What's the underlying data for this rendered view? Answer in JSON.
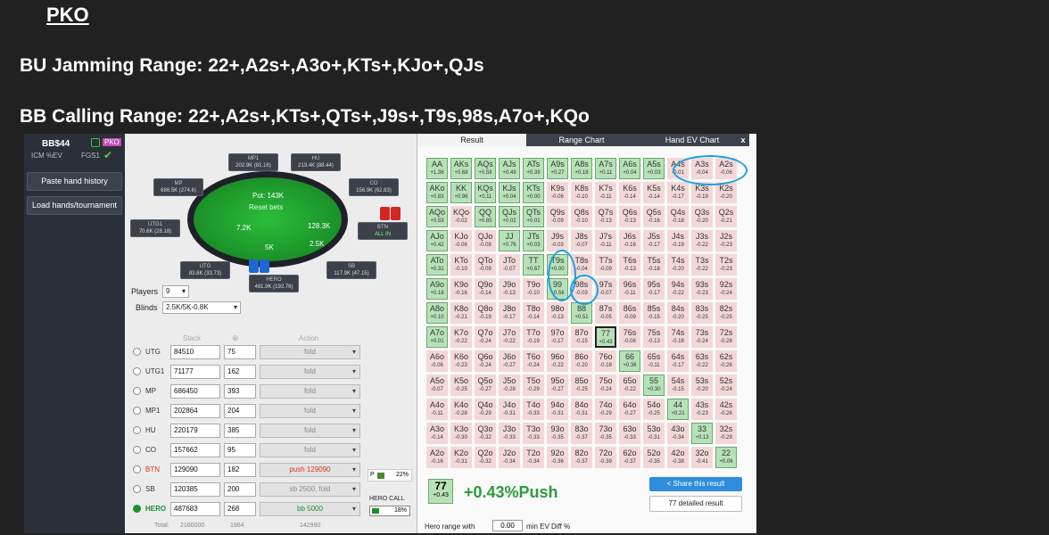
{
  "slide": {
    "title": "PKO",
    "bu_range": "BU Jamming Range: 22+,A2s+,A3o+,KTs+,KJo+,QJs",
    "bb_range": "BB Calling Range: 22+,A2s+,KTs+,QTs+,J9s+,T9s,98s,A7o+,KQo"
  },
  "sidebar": {
    "stack_label": "BB$44",
    "pko_badge": "PKO",
    "icm_label": "ICM %EV",
    "fgs_label": "FGS1",
    "paste_button": "Paste hand history",
    "load_button": "Load hands/tournament"
  },
  "table": {
    "pot": "Pot: 143K",
    "reset_bets": "Reset bets",
    "bet_left": "7.2K",
    "bet_center": "5K",
    "bet_right1": "128.3K",
    "bet_right2": "2.5K",
    "seats": [
      {
        "name": "MP1",
        "stack": "202.9K (81.16)"
      },
      {
        "name": "HU",
        "stack": "219.4K (88.44)"
      },
      {
        "name": "MP",
        "stack": "686.5K (274.6)"
      },
      {
        "name": "CO",
        "stack": "156.9K (62.83)"
      },
      {
        "name": "UTG1",
        "stack": "70.6K (28.18)"
      },
      {
        "name": "BTN",
        "stack": "ALL IN"
      },
      {
        "name": "UTG",
        "stack": "83.8K (33.73)"
      },
      {
        "name": "SB",
        "stack": "117.9K (47.15)"
      },
      {
        "name": "HERO",
        "stack": "481.9K (192.76)"
      }
    ],
    "players_label": "Players",
    "players_value": "9",
    "blinds_label": "Blinds",
    "blinds_value": "2.5K/5K-0.8K",
    "col_stack": "Stack",
    "col_action": "Action"
  },
  "positions": [
    {
      "name": "UTG",
      "stack": "84510",
      "bb": "75",
      "action": "fold",
      "selected": false
    },
    {
      "name": "UTG1",
      "stack": "71177",
      "bb": "162",
      "action": "fold",
      "selected": false
    },
    {
      "name": "MP",
      "stack": "686450",
      "bb": "393",
      "action": "fold",
      "selected": false
    },
    {
      "name": "MP1",
      "stack": "202864",
      "bb": "204",
      "action": "fold",
      "selected": false
    },
    {
      "name": "HU",
      "stack": "220179",
      "bb": "385",
      "action": "fold",
      "selected": false
    },
    {
      "name": "CO",
      "stack": "157662",
      "bb": "95",
      "action": "fold",
      "selected": false
    },
    {
      "name": "BTN",
      "stack": "129090",
      "bb": "182",
      "action": "push 129090",
      "selected": false
    },
    {
      "name": "SB",
      "stack": "120385",
      "bb": "200",
      "action": "sb 2500, fold",
      "selected": false
    },
    {
      "name": "HERO",
      "stack": "487683",
      "bb": "268",
      "action": "bb 5000",
      "selected": true
    }
  ],
  "totals": {
    "label": "Total:",
    "stack": "2160000",
    "bb": "1964",
    "action": "142990"
  },
  "side_stats": {
    "p_label": "P",
    "p_value": "22%",
    "hero_call_label": "HERO CALL",
    "hero_call_value": "18%"
  },
  "results": {
    "tabs": [
      "Result",
      "Range Chart",
      "Hand EV Chart"
    ],
    "close": "x",
    "hand": "77",
    "hand_ev": "+0.43",
    "summary": "+0.43%Push",
    "share": "Share this result",
    "detailed": "77 detailed result",
    "footer_label": "Hero range with",
    "footer_value": "0.00",
    "footer_suffix": "min EV Diff %",
    "colors": {
      "push": "#b7e2b8",
      "fold": "#f3d8d8",
      "ring": "#1aa0e0"
    }
  },
  "grid": [
    [
      [
        "AA",
        "+1.36"
      ],
      [
        "AKs",
        "+0.68"
      ],
      [
        "AQs",
        "+0.58"
      ],
      [
        "AJs",
        "+0.49"
      ],
      [
        "ATs",
        "+0.39"
      ],
      [
        "A9s",
        "+0.27"
      ],
      [
        "A8s",
        "+0.18"
      ],
      [
        "A7s",
        "+0.11"
      ],
      [
        "A6s",
        "+0.04"
      ],
      [
        "A5s",
        "+0.03"
      ],
      [
        "A4s",
        "-0.01"
      ],
      [
        "A3s",
        "-0.04"
      ],
      [
        "A2s",
        "-0.06"
      ]
    ],
    [
      [
        "AKo",
        "+0.83"
      ],
      [
        "KK",
        "+0.96"
      ],
      [
        "KQs",
        "+0.11"
      ],
      [
        "KJs",
        "+0.04"
      ],
      [
        "KTs",
        "+0.00"
      ],
      [
        "K9s",
        "-0.06"
      ],
      [
        "K8s",
        "-0.10"
      ],
      [
        "K7s",
        "-0.11"
      ],
      [
        "K6s",
        "-0.14"
      ],
      [
        "K5s",
        "-0.14"
      ],
      [
        "K4s",
        "-0.17"
      ],
      [
        "K3s",
        "-0.19"
      ],
      [
        "K2s",
        "-0.20"
      ]
    ],
    [
      [
        "AQo",
        "+0.53"
      ],
      [
        "KQo",
        "-0.02"
      ],
      [
        "QQ",
        "+0.85"
      ],
      [
        "QJs",
        "+0.02"
      ],
      [
        "QTs",
        "+0.01"
      ],
      [
        "Q9s",
        "-0.09"
      ],
      [
        "Q8s",
        "-0.10"
      ],
      [
        "Q7s",
        "-0.13"
      ],
      [
        "Q6s",
        "-0.13"
      ],
      [
        "Q5s",
        "-0.16"
      ],
      [
        "Q4s",
        "-0.18"
      ],
      [
        "Q3s",
        "-0.20"
      ],
      [
        "Q2s",
        "-0.21"
      ]
    ],
    [
      [
        "AJo",
        "+0.42"
      ],
      [
        "KJo",
        "-0.06"
      ],
      [
        "QJo",
        "-0.08"
      ],
      [
        "JJ",
        "+0.76"
      ],
      [
        "JTs",
        "+0.03"
      ],
      [
        "J9s",
        "-0.03"
      ],
      [
        "J8s",
        "-0.07"
      ],
      [
        "J7s",
        "-0.11"
      ],
      [
        "J6s",
        "-0.16"
      ],
      [
        "J5s",
        "-0.17"
      ],
      [
        "J4s",
        "-0.19"
      ],
      [
        "J3s",
        "-0.22"
      ],
      [
        "J2s",
        "-0.23"
      ]
    ],
    [
      [
        "ATo",
        "+0.31"
      ],
      [
        "KTo",
        "-0.10"
      ],
      [
        "QTo",
        "-0.09"
      ],
      [
        "JTo",
        "-0.07"
      ],
      [
        "TT",
        "+0.67"
      ],
      [
        "T9s",
        "+0.00"
      ],
      [
        "T8s",
        "-0.04"
      ],
      [
        "T7s",
        "-0.09"
      ],
      [
        "T6s",
        "-0.13"
      ],
      [
        "T5s",
        "-0.18"
      ],
      [
        "T4s",
        "-0.20"
      ],
      [
        "T3s",
        "-0.22"
      ],
      [
        "T2s",
        "-0.23"
      ]
    ],
    [
      [
        "A9o",
        "+0.18"
      ],
      [
        "K9o",
        "-0.16"
      ],
      [
        "Q9o",
        "-0.14"
      ],
      [
        "J9o",
        "-0.13"
      ],
      [
        "T9o",
        "-0.10"
      ],
      [
        "99",
        "+0.56"
      ],
      [
        "98s",
        "-0.03"
      ],
      [
        "97s",
        "-0.07"
      ],
      [
        "96s",
        "-0.11"
      ],
      [
        "95s",
        "-0.17"
      ],
      [
        "94s",
        "-0.22"
      ],
      [
        "93s",
        "-0.23"
      ],
      [
        "92s",
        "-0.24"
      ]
    ],
    [
      [
        "A8o",
        "+0.10"
      ],
      [
        "K8o",
        "-0.21"
      ],
      [
        "Q8o",
        "-0.19"
      ],
      [
        "J8o",
        "-0.17"
      ],
      [
        "T8o",
        "-0.14"
      ],
      [
        "98o",
        "-0.13"
      ],
      [
        "88",
        "+0.51"
      ],
      [
        "87s",
        "-0.05"
      ],
      [
        "86s",
        "-0.09"
      ],
      [
        "85s",
        "-0.15"
      ],
      [
        "84s",
        "-0.20"
      ],
      [
        "83s",
        "-0.25"
      ],
      [
        "82s",
        "-0.25"
      ]
    ],
    [
      [
        "A7o",
        "+0.01"
      ],
      [
        "K7o",
        "-0.22"
      ],
      [
        "Q7o",
        "-0.24"
      ],
      [
        "J7o",
        "-0.22"
      ],
      [
        "T7o",
        "-0.19"
      ],
      [
        "97o",
        "-0.17"
      ],
      [
        "87o",
        "-0.15"
      ],
      [
        "77",
        "+0.43"
      ],
      [
        "76s",
        "-0.08"
      ],
      [
        "75s",
        "-0.13"
      ],
      [
        "74s",
        "-0.18"
      ],
      [
        "73s",
        "-0.24"
      ],
      [
        "72s",
        "-0.28"
      ]
    ],
    [
      [
        "A6o",
        "-0.06"
      ],
      [
        "K6o",
        "-0.23"
      ],
      [
        "Q6o",
        "-0.24"
      ],
      [
        "J6o",
        "-0.27"
      ],
      [
        "T6o",
        "-0.24"
      ],
      [
        "96o",
        "-0.22"
      ],
      [
        "86o",
        "-0.20"
      ],
      [
        "76o",
        "-0.18"
      ],
      [
        "66",
        "+0.36"
      ],
      [
        "65s",
        "-0.11"
      ],
      [
        "64s",
        "-0.17"
      ],
      [
        "63s",
        "-0.22"
      ],
      [
        "62s",
        "-0.26"
      ]
    ],
    [
      [
        "A5o",
        "-0.07"
      ],
      [
        "K5o",
        "-0.25"
      ],
      [
        "Q5o",
        "-0.27"
      ],
      [
        "J5o",
        "-0.28"
      ],
      [
        "T5o",
        "-0.29"
      ],
      [
        "95o",
        "-0.27"
      ],
      [
        "85o",
        "-0.25"
      ],
      [
        "75o",
        "-0.24"
      ],
      [
        "65o",
        "-0.22"
      ],
      [
        "55",
        "+0.30"
      ],
      [
        "54s",
        "-0.15"
      ],
      [
        "53s",
        "-0.20"
      ],
      [
        "52s",
        "-0.24"
      ]
    ],
    [
      [
        "A4o",
        "-0.11"
      ],
      [
        "K4o",
        "-0.28"
      ],
      [
        "Q4o",
        "-0.29"
      ],
      [
        "J4o",
        "-0.31"
      ],
      [
        "T4o",
        "-0.33"
      ],
      [
        "94o",
        "-0.31"
      ],
      [
        "84o",
        "-0.31"
      ],
      [
        "74o",
        "-0.29"
      ],
      [
        "64o",
        "-0.27"
      ],
      [
        "54o",
        "-0.25"
      ],
      [
        "44",
        "+0.21"
      ],
      [
        "43s",
        "-0.23"
      ],
      [
        "42s",
        "-0.26"
      ]
    ],
    [
      [
        "A3o",
        "-0.14"
      ],
      [
        "K3o",
        "-0.30"
      ],
      [
        "Q3o",
        "-0.32"
      ],
      [
        "J3o",
        "-0.33"
      ],
      [
        "T3o",
        "-0.33"
      ],
      [
        "93o",
        "-0.35"
      ],
      [
        "83o",
        "-0.37"
      ],
      [
        "73o",
        "-0.35"
      ],
      [
        "63o",
        "-0.33"
      ],
      [
        "53o",
        "-0.31"
      ],
      [
        "43o",
        "-0.34"
      ],
      [
        "33",
        "+0.13"
      ],
      [
        "32s",
        "-0.29"
      ]
    ],
    [
      [
        "A2o",
        "-0.16"
      ],
      [
        "K2o",
        "-0.31"
      ],
      [
        "Q2o",
        "-0.32"
      ],
      [
        "J2o",
        "-0.34"
      ],
      [
        "T2o",
        "-0.34"
      ],
      [
        "92o",
        "-0.36"
      ],
      [
        "82o",
        "-0.37"
      ],
      [
        "72o",
        "-0.39"
      ],
      [
        "62o",
        "-0.37"
      ],
      [
        "52o",
        "-0.35"
      ],
      [
        "42o",
        "-0.38"
      ],
      [
        "32o",
        "-0.41"
      ],
      [
        "22",
        "+0.06"
      ]
    ]
  ]
}
